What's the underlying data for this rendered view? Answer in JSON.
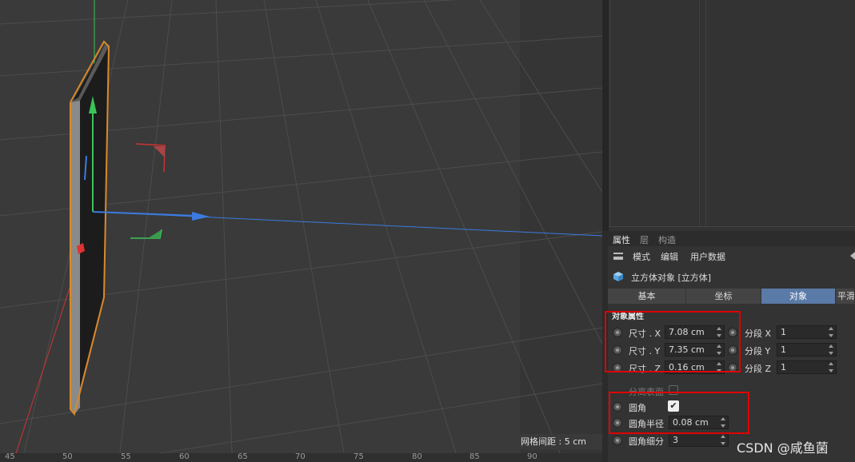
{
  "viewport": {
    "grid_spacing": "网格间距 : 5 cm",
    "ruler_ticks": [
      "45",
      "50",
      "55",
      "60",
      "65",
      "70",
      "75",
      "80",
      "85",
      "90"
    ],
    "colors": {
      "background": "#3a3a3a",
      "grid": "#4a4a4a",
      "x_axis": "#3b7be0",
      "y_axis": "#3bc45a",
      "z_axis": "#cc3333",
      "selection": "#d98a2b"
    }
  },
  "attributes": {
    "tabs": [
      "属性",
      "层",
      "构造"
    ],
    "menu": [
      "模式",
      "编辑",
      "用户数据"
    ],
    "object_title": "立方体对象 [立方体]",
    "sub_tabs": [
      "基本",
      "坐标",
      "对象",
      "平滑"
    ],
    "active_sub_tab": "对象",
    "section_title": "对象属性",
    "params": [
      {
        "label": "尺寸 . X",
        "value": "7.08 cm",
        "seg_label": "分段 X",
        "seg_value": "1"
      },
      {
        "label": "尺寸 . Y",
        "value": "7.35 cm",
        "seg_label": "分段 Y",
        "seg_value": "1"
      },
      {
        "label": "尺寸 . Z",
        "value": "0.16 cm",
        "seg_label": "分段 Z",
        "seg_value": "1"
      }
    ],
    "separate_surfaces_label": "分离表面",
    "fillet_label": "圆角",
    "fillet_checked": true,
    "fillet_check_glyph": "✔",
    "fillet_radius_label": "圆角半径",
    "fillet_radius_value": "0.08 cm",
    "fillet_subdiv_label": "圆角细分",
    "fillet_subdiv_value": "3",
    "accent_color": "#5a7ba8"
  },
  "watermark": "CSDN @咸鱼菌"
}
